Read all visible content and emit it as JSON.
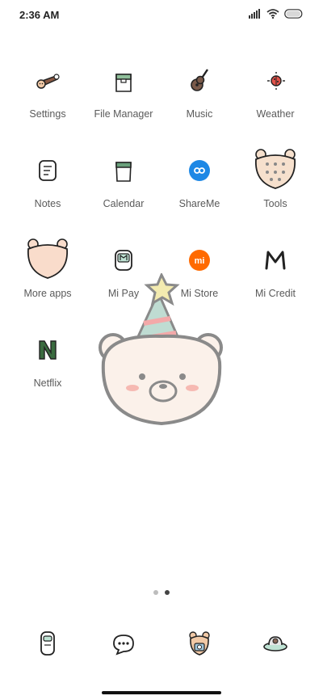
{
  "status_bar": {
    "time": "2:36 AM",
    "icons": [
      "signal-icon",
      "wifi-icon",
      "battery-icon"
    ]
  },
  "apps": [
    {
      "label": "Settings",
      "icon": "settings-icon"
    },
    {
      "label": "File Manager",
      "icon": "file-manager-icon"
    },
    {
      "label": "Music",
      "icon": "music-guitar-icon"
    },
    {
      "label": "Weather",
      "icon": "weather-ladybug-icon"
    },
    {
      "label": "Notes",
      "icon": "notes-icon"
    },
    {
      "label": "Calendar",
      "icon": "calendar-icon"
    },
    {
      "label": "ShareMe",
      "icon": "shareme-icon"
    },
    {
      "label": "Tools",
      "icon": "tools-folder-icon"
    },
    {
      "label": "More apps",
      "icon": "more-apps-folder-icon"
    },
    {
      "label": "Mi Pay",
      "icon": "mi-pay-icon"
    },
    {
      "label": "Mi Store",
      "icon": "mi-store-icon"
    },
    {
      "label": "Mi Credit",
      "icon": "mi-credit-icon"
    },
    {
      "label": "Netflix",
      "icon": "netflix-icon"
    }
  ],
  "page_indicator": {
    "count": 2,
    "active": 1
  },
  "dock": [
    {
      "icon": "phone-icon"
    },
    {
      "icon": "messages-icon"
    },
    {
      "icon": "camera-bear-icon"
    },
    {
      "icon": "browser-ufo-icon"
    }
  ],
  "colors": {
    "accent_blue": "#1e88e5",
    "mi_orange": "#ff6a00",
    "netflix_green": "#3a6b3f",
    "bear_fill": "#f6e6d6",
    "outline": "#222222"
  }
}
